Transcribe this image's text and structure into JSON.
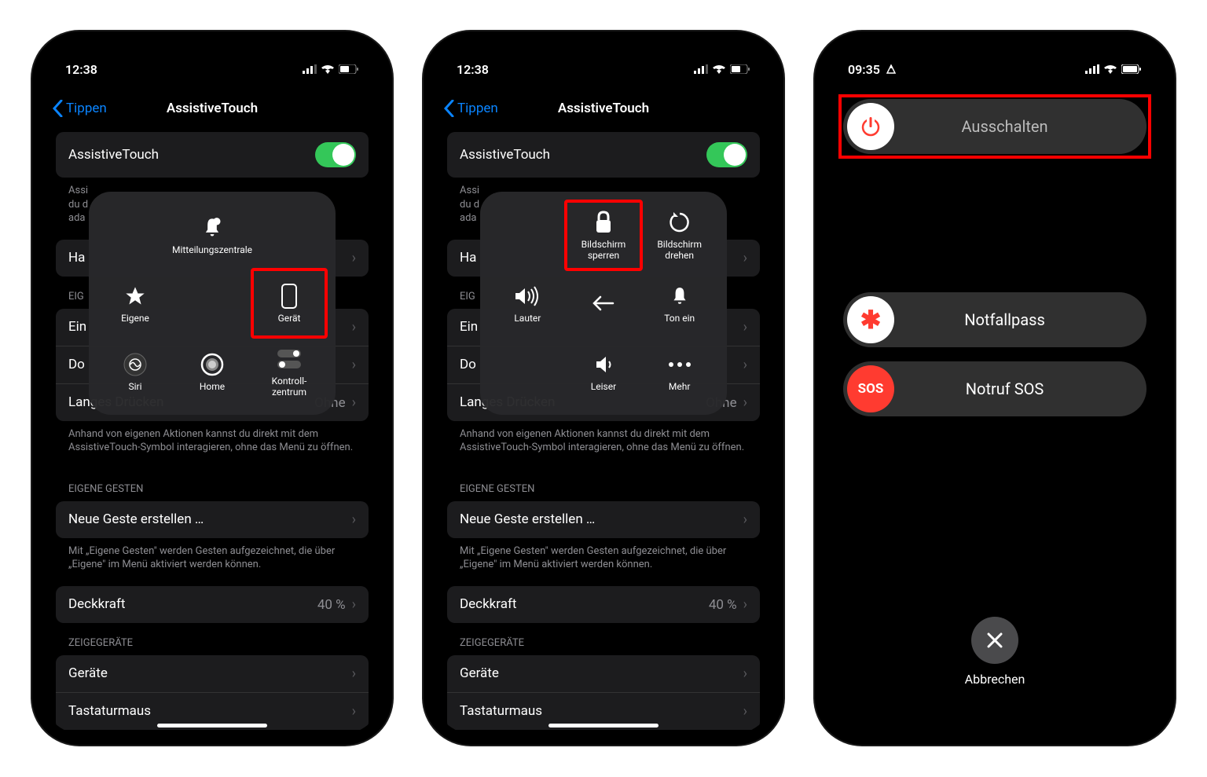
{
  "phone12": {
    "time": "12:38",
    "back_label": "Tippen",
    "title": "AssistiveTouch",
    "toggle_label": "AssistiveTouch",
    "toggle_footer_partial": "Assi\ndu d\nada",
    "ha_label": "Ha",
    "eig_header": "EIG",
    "ein_label": "Ein",
    "do_label": "Do",
    "long_press_label": "Langes Drücken",
    "long_press_value": "Ohne",
    "long_press_footer": "Anhand von eigenen Aktionen kannst du direkt mit dem AssistiveTouch-Symbol interagieren, ohne das Menü zu öffnen.",
    "gestures_header": "EIGENE GESTEN",
    "new_gesture_label": "Neue Geste erstellen …",
    "gestures_footer": "Mit „Eigene Gesten\" werden Gesten aufgezeichnet, die über „Eigene\" im Menü aktiviert werden können.",
    "opacity_label": "Deckkraft",
    "opacity_value": "40 %",
    "devices_header": "ZEIGEGERÄTE",
    "devices_label": "Geräte",
    "keyboard_mouse_label": "Tastaturmaus"
  },
  "menu1": {
    "notifications": "Mitteilungszentrale",
    "custom": "Eigene",
    "device": "Gerät",
    "siri": "Siri",
    "home": "Home",
    "control_center": "Kontroll-\nzentrum"
  },
  "menu2": {
    "lock_screen": "Bildschirm\nsperren",
    "rotate": "Bildschirm\ndrehen",
    "volume_up": "Lauter",
    "sound_on": "Ton ein",
    "volume_down": "Leiser",
    "more": "Mehr"
  },
  "phone3": {
    "time": "09:35",
    "power_off": "Ausschalten",
    "medical_id": "Notfallpass",
    "sos": "Notruf SOS",
    "sos_badge": "SOS",
    "cancel": "Abbrechen"
  }
}
